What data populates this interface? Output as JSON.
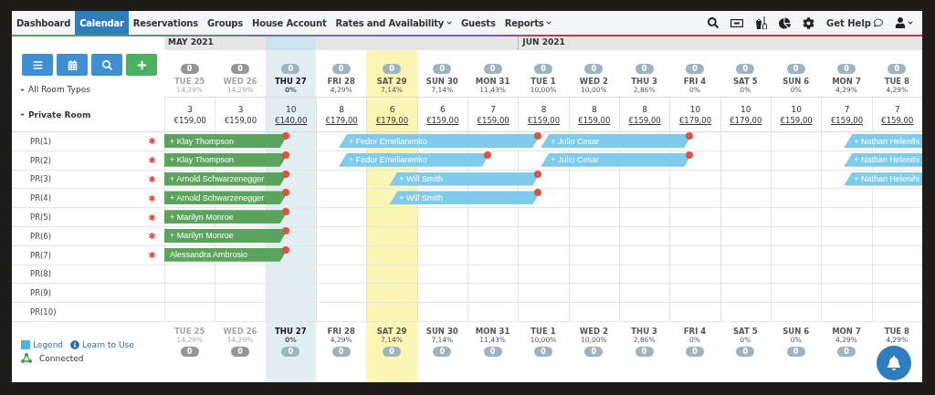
{
  "nav": {
    "items": [
      {
        "label": "Dashboard",
        "selected": false,
        "has_menu": false
      },
      {
        "label": "Calendar",
        "selected": true,
        "has_menu": false
      },
      {
        "label": "Reservations",
        "selected": false,
        "has_menu": false
      },
      {
        "label": "Groups",
        "selected": false,
        "has_menu": false
      },
      {
        "label": "House Account",
        "selected": false,
        "has_menu": false
      },
      {
        "label": "Rates and Availability",
        "selected": false,
        "has_menu": true
      },
      {
        "label": "Guests",
        "selected": false,
        "has_menu": false
      },
      {
        "label": "Reports",
        "selected": false,
        "has_menu": true
      }
    ],
    "help": "Get Help"
  },
  "calendar": {
    "room_types_label": "All Room Types",
    "room_type": "Private Room",
    "days": [
      {
        "month": "MAY 2021",
        "label": "TUE 25",
        "occupancy": "14,29%",
        "count": "0",
        "available": "3",
        "price": "€159,00",
        "past": true,
        "today": false,
        "selected": false
      },
      {
        "label": "WED 26",
        "occupancy": "14,29%",
        "count": "0",
        "available": "3",
        "price": "€159,00",
        "past": true,
        "today": false,
        "selected": false
      },
      {
        "label": "THU 27",
        "occupancy": "0%",
        "count": "0",
        "available": "10",
        "price": "€140,00",
        "past": false,
        "today": true,
        "selected": false
      },
      {
        "label": "FRI 28",
        "occupancy": "4,29%",
        "count": "0",
        "available": "8",
        "price": "€179,00",
        "past": false,
        "today": false,
        "selected": false
      },
      {
        "label": "SAT 29",
        "occupancy": "7,14%",
        "count": "0",
        "available": "6",
        "price": "€179,00",
        "past": false,
        "today": false,
        "selected": true
      },
      {
        "label": "SUN 30",
        "occupancy": "7,14%",
        "count": "0",
        "available": "6",
        "price": "€159,00",
        "past": false,
        "today": false,
        "selected": false
      },
      {
        "label": "MON 31",
        "occupancy": "11,43%",
        "count": "0",
        "available": "7",
        "price": "€159,00",
        "past": false,
        "today": false,
        "selected": false
      },
      {
        "month": "JUN 2021",
        "label": "TUE 1",
        "occupancy": "10,00%",
        "count": "0",
        "available": "8",
        "price": "€159,00",
        "past": false,
        "today": false,
        "selected": false
      },
      {
        "label": "WED 2",
        "occupancy": "10,00%",
        "count": "0",
        "available": "8",
        "price": "€159,00",
        "past": false,
        "today": false,
        "selected": false
      },
      {
        "label": "THU 3",
        "occupancy": "2,86%",
        "count": "0",
        "available": "8",
        "price": "€159,00",
        "past": false,
        "today": false,
        "selected": false
      },
      {
        "label": "FRI 4",
        "occupancy": "0%",
        "count": "0",
        "available": "10",
        "price": "€179,00",
        "past": false,
        "today": false,
        "selected": false
      },
      {
        "label": "SAT 5",
        "occupancy": "0%",
        "count": "0",
        "available": "10",
        "price": "€179,00",
        "past": false,
        "today": false,
        "selected": false
      },
      {
        "label": "SUN 6",
        "occupancy": "0%",
        "count": "0",
        "available": "10",
        "price": "€159,00",
        "past": false,
        "today": false,
        "selected": false
      },
      {
        "label": "MON 7",
        "occupancy": "4,29%",
        "count": "0",
        "available": "7",
        "price": "€159,00",
        "past": false,
        "today": false,
        "selected": false
      },
      {
        "label": "TUE 8",
        "occupancy": "4,29%",
        "count": "0",
        "available": "7",
        "price": "€159,00",
        "past": false,
        "today": false,
        "selected": false
      }
    ],
    "rooms": [
      {
        "name": "PR(1)",
        "flagged": true,
        "cells": [
          {
            "kind": "arrival",
            "guest": "+ Klay Thompson",
            "checked_in": true,
            "continued": true
          },
          {
            "kind": "night"
          },
          {
            "kind": "free"
          },
          {
            "kind": "arrival",
            "guest": "+ Fedor Emelianenko",
            "checked_in": false,
            "continued": false
          },
          {
            "kind": "night"
          },
          {
            "kind": "night"
          },
          {
            "kind": "night"
          },
          {
            "kind": "arrival",
            "guest": "+ Julio Cesar",
            "checked_in": false,
            "continued": false
          },
          {
            "kind": "night"
          },
          {
            "kind": "night"
          },
          {
            "kind": "free"
          },
          {
            "kind": "free"
          },
          {
            "kind": "free"
          },
          {
            "kind": "arrival",
            "guest": "+ Nathan Helenihi",
            "checked_in": false,
            "continued": false
          },
          {
            "kind": "night"
          }
        ]
      },
      {
        "name": "PR(2)",
        "flagged": true,
        "cells": [
          {
            "kind": "arrival",
            "guest": "+ Klay Thompson",
            "checked_in": true,
            "continued": true
          },
          {
            "kind": "night"
          },
          {
            "kind": "free"
          },
          {
            "kind": "arrival",
            "guest": "+ Fedor Emelianenko",
            "checked_in": false,
            "continued": false
          },
          {
            "kind": "night"
          },
          {
            "kind": "night"
          },
          {
            "kind": "free"
          },
          {
            "kind": "arrival",
            "guest": "+ Julio Cesar",
            "checked_in": false,
            "continued": false
          },
          {
            "kind": "night"
          },
          {
            "kind": "night"
          },
          {
            "kind": "free"
          },
          {
            "kind": "free"
          },
          {
            "kind": "free"
          },
          {
            "kind": "arrival",
            "guest": "+ Nathan Helenihi",
            "checked_in": false,
            "continued": false
          },
          {
            "kind": "night"
          }
        ]
      },
      {
        "name": "PR(3)",
        "flagged": true,
        "cells": [
          {
            "kind": "arrival",
            "guest": "+ Arnold Schwarzenegger",
            "checked_in": true,
            "continued": true
          },
          {
            "kind": "night"
          },
          {
            "kind": "free"
          },
          {
            "kind": "free"
          },
          {
            "kind": "arrival",
            "guest": "+ Will Smith",
            "checked_in": false,
            "continued": false
          },
          {
            "kind": "night"
          },
          {
            "kind": "night"
          },
          {
            "kind": "free"
          },
          {
            "kind": "free"
          },
          {
            "kind": "free"
          },
          {
            "kind": "free"
          },
          {
            "kind": "free"
          },
          {
            "kind": "free"
          },
          {
            "kind": "arrival",
            "guest": "+ Nathan Helenihi",
            "checked_in": false,
            "continued": false
          },
          {
            "kind": "night"
          }
        ]
      },
      {
        "name": "PR(4)",
        "flagged": true,
        "cells": [
          {
            "kind": "arrival",
            "guest": "+ Arnold Schwarzenegger",
            "checked_in": true,
            "continued": true
          },
          {
            "kind": "night"
          },
          {
            "kind": "free"
          },
          {
            "kind": "free"
          },
          {
            "kind": "arrival",
            "guest": "+ Will Smith",
            "checked_in": false,
            "continued": false
          },
          {
            "kind": "night"
          },
          {
            "kind": "night"
          },
          {
            "kind": "free"
          },
          {
            "kind": "free"
          },
          {
            "kind": "free"
          },
          {
            "kind": "free"
          },
          {
            "kind": "free"
          },
          {
            "kind": "free"
          },
          {
            "kind": "free"
          },
          {
            "kind": "free"
          }
        ]
      },
      {
        "name": "PR(5)",
        "flagged": true,
        "cells": [
          {
            "kind": "arrival",
            "guest": "+ Marilyn Monroe",
            "checked_in": true,
            "continued": true
          },
          {
            "kind": "night"
          },
          {
            "kind": "free"
          },
          {
            "kind": "free"
          },
          {
            "kind": "free"
          },
          {
            "kind": "free"
          },
          {
            "kind": "free"
          },
          {
            "kind": "free"
          },
          {
            "kind": "free"
          },
          {
            "kind": "free"
          },
          {
            "kind": "free"
          },
          {
            "kind": "free"
          },
          {
            "kind": "free"
          },
          {
            "kind": "free"
          },
          {
            "kind": "free"
          }
        ]
      },
      {
        "name": "PR(6)",
        "flagged": true,
        "cells": [
          {
            "kind": "arrival",
            "guest": "+ Marilyn Monroe",
            "checked_in": true,
            "continued": true
          },
          {
            "kind": "night"
          },
          {
            "kind": "free"
          },
          {
            "kind": "free"
          },
          {
            "kind": "free"
          },
          {
            "kind": "free"
          },
          {
            "kind": "free"
          },
          {
            "kind": "free"
          },
          {
            "kind": "free"
          },
          {
            "kind": "free"
          },
          {
            "kind": "free"
          },
          {
            "kind": "free"
          },
          {
            "kind": "free"
          },
          {
            "kind": "free"
          },
          {
            "kind": "free"
          }
        ]
      },
      {
        "name": "PR(7)",
        "flagged": true,
        "cells": [
          {
            "kind": "arrival",
            "guest": "Alessandra Ambrosio",
            "checked_in": true,
            "continued": true
          },
          {
            "kind": "night"
          },
          {
            "kind": "free"
          },
          {
            "kind": "free"
          },
          {
            "kind": "free"
          },
          {
            "kind": "free"
          },
          {
            "kind": "free"
          },
          {
            "kind": "free"
          },
          {
            "kind": "free"
          },
          {
            "kind": "free"
          },
          {
            "kind": "free"
          },
          {
            "kind": "free"
          },
          {
            "kind": "free"
          },
          {
            "kind": "free"
          },
          {
            "kind": "free"
          }
        ]
      },
      {
        "name": "PR(8)",
        "flagged": false,
        "cells": [
          {
            "kind": "free"
          },
          {
            "kind": "free"
          },
          {
            "kind": "free"
          },
          {
            "kind": "free"
          },
          {
            "kind": "free"
          },
          {
            "kind": "free"
          },
          {
            "kind": "free"
          },
          {
            "kind": "free"
          },
          {
            "kind": "free"
          },
          {
            "kind": "free"
          },
          {
            "kind": "free"
          },
          {
            "kind": "free"
          },
          {
            "kind": "free"
          },
          {
            "kind": "free"
          },
          {
            "kind": "free"
          }
        ]
      },
      {
        "name": "PR(9)",
        "flagged": false,
        "cells": [
          {
            "kind": "free"
          },
          {
            "kind": "free"
          },
          {
            "kind": "free"
          },
          {
            "kind": "free"
          },
          {
            "kind": "free"
          },
          {
            "kind": "free"
          },
          {
            "kind": "free"
          },
          {
            "kind": "free"
          },
          {
            "kind": "free"
          },
          {
            "kind": "free"
          },
          {
            "kind": "free"
          },
          {
            "kind": "free"
          },
          {
            "kind": "free"
          },
          {
            "kind": "free"
          },
          {
            "kind": "free"
          }
        ]
      },
      {
        "name": "PR(10)",
        "flagged": false,
        "cells": [
          {
            "kind": "free"
          },
          {
            "kind": "free"
          },
          {
            "kind": "free"
          },
          {
            "kind": "free"
          },
          {
            "kind": "free"
          },
          {
            "kind": "free"
          },
          {
            "kind": "free"
          },
          {
            "kind": "free"
          },
          {
            "kind": "free"
          },
          {
            "kind": "free"
          },
          {
            "kind": "free"
          },
          {
            "kind": "free"
          },
          {
            "kind": "free"
          },
          {
            "kind": "free"
          },
          {
            "kind": "free"
          }
        ]
      }
    ],
    "footer_days": [
      {
        "label": "TUE 25",
        "occupancy": "14,29%",
        "count": "0",
        "past": true,
        "today": false,
        "selected": false
      },
      {
        "label": "WED 26",
        "occupancy": "14,29%",
        "count": "0",
        "past": true,
        "today": false,
        "selected": false
      },
      {
        "label": "THU 27",
        "occupancy": "0%",
        "count": "0",
        "past": false,
        "today": true,
        "selected": false
      },
      {
        "label": "FRI 28",
        "occupancy": "4,29%",
        "count": "0",
        "past": false,
        "today": false,
        "selected": false
      },
      {
        "label": "SAT 29",
        "occupancy": "7,14%",
        "count": "0",
        "past": false,
        "today": false,
        "selected": true
      },
      {
        "label": "SUN 30",
        "occupancy": "7,14%",
        "count": "0",
        "past": false,
        "today": false,
        "selected": false
      },
      {
        "label": "MON 31",
        "occupancy": "11,43%",
        "count": "0",
        "past": false,
        "today": false,
        "selected": false
      },
      {
        "label": "TUE 1",
        "occupancy": "10,00%",
        "count": "0",
        "past": false,
        "today": false,
        "selected": false
      },
      {
        "label": "WED 2",
        "occupancy": "10,00%",
        "count": "0",
        "past": false,
        "today": false,
        "selected": false
      },
      {
        "label": "THU 3",
        "occupancy": "2,86%",
        "count": "0",
        "past": false,
        "today": false,
        "selected": false
      },
      {
        "label": "FRI 4",
        "occupancy": "0%",
        "count": "0",
        "past": false,
        "today": false,
        "selected": false
      },
      {
        "label": "SAT 5",
        "occupancy": "0%",
        "count": "0",
        "past": false,
        "today": false,
        "selected": false
      },
      {
        "label": "SUN 6",
        "occupancy": "0%",
        "count": "0",
        "past": false,
        "today": false,
        "selected": false
      },
      {
        "label": "MON 7",
        "occupancy": "4,29%",
        "count": "0",
        "past": false,
        "today": false,
        "selected": false
      },
      {
        "label": "TUE 8",
        "occupancy": "4,29%",
        "past": false,
        "today": false,
        "selected": false
      }
    ]
  },
  "footer": {
    "legend": "Legend",
    "learn": "Learn to Use",
    "status": "Connected"
  }
}
